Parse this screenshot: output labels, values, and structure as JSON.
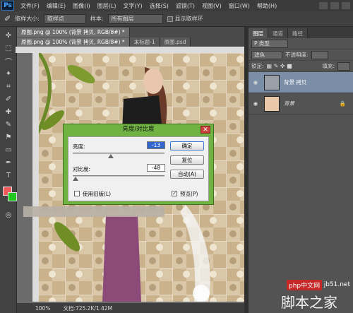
{
  "app": {
    "logo": "Ps"
  },
  "menu": [
    "文件(F)",
    "编辑(E)",
    "图像(I)",
    "图层(L)",
    "文字(Y)",
    "选择(S)",
    "滤镜(T)",
    "视图(V)",
    "窗口(W)",
    "帮助(H)"
  ],
  "options": {
    "sample_size_label": "取样大小:",
    "sample_size_value": "取样点",
    "sample_label": "样本:",
    "sample_value": "所有图层",
    "show_ring_label": "显示取样环"
  },
  "tabs_row1": [
    {
      "label": "原图.png @ 100% (背景 拷贝, RGB/8#) *"
    }
  ],
  "tabs_row2": [
    {
      "label": "原图.png @ 100% (背景 拷贝, RGB/8#) *"
    },
    {
      "label": "未标题-1"
    },
    {
      "label": "原图.psd"
    }
  ],
  "status": {
    "zoom": "100%",
    "doc_info": "文档:725.2K/1.42M"
  },
  "panel": {
    "tabs": [
      "图层",
      "通道",
      "路径"
    ],
    "filter_label": "P 类型",
    "blend_mode": "滤色",
    "opacity_label": "不透明度:",
    "lock_label": "锁定:",
    "fill_label": "填充:",
    "layers": [
      {
        "name": "背景 拷贝",
        "selected": true
      },
      {
        "name": "背景",
        "selected": false
      }
    ]
  },
  "dialog": {
    "title": "亮度/对比度",
    "brightness_label": "亮度:",
    "brightness_value": "-13",
    "contrast_label": "对比度:",
    "contrast_value": "-48",
    "ok_label": "确定",
    "reset_label": "复位",
    "auto_label": "自动(A)",
    "legacy_label": "使用旧版(L)",
    "preview_label": "预览(P)",
    "preview_checked": true,
    "legacy_checked": false
  },
  "watermark": {
    "site": "php中文网",
    "domain": "jb51.net",
    "brand": "脚本之家"
  },
  "colors": {
    "foreground": "#f05a5a",
    "background": "#1ec81e",
    "dialog_frame": "#71b343"
  }
}
